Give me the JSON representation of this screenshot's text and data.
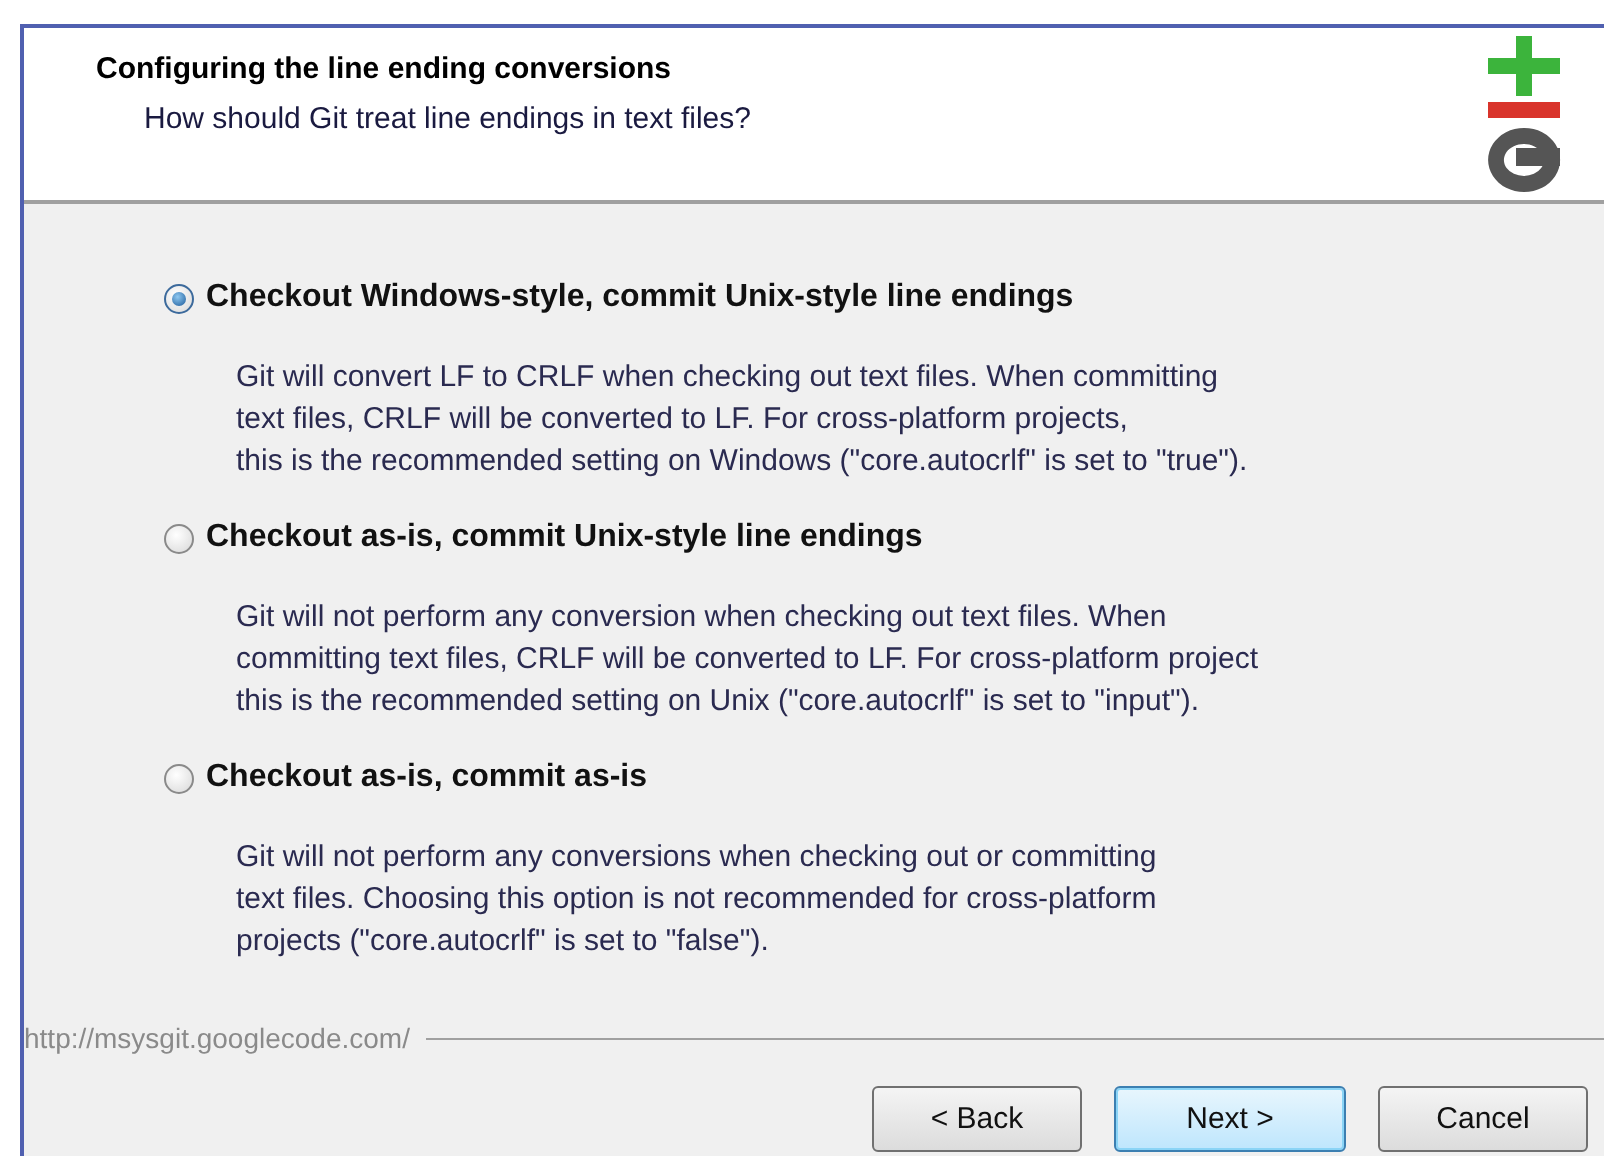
{
  "header": {
    "title": "Configuring the line ending conversions",
    "subtitle": "How should Git treat line endings in text files?"
  },
  "options": [
    {
      "label": "Checkout Windows-style, commit Unix-style line endings",
      "selected": true,
      "description": [
        "Git will convert LF to CRLF when checking out text files. When committing",
        "text files, CRLF will be converted to LF. For cross-platform projects,",
        "this is the recommended setting on Windows (\"core.autocrlf\" is set to \"true\")."
      ]
    },
    {
      "label": "Checkout as-is, commit Unix-style line endings",
      "selected": false,
      "description": [
        "Git will not perform any conversion when checking out text files. When",
        "committing text files, CRLF will be converted to LF. For cross-platform project",
        "this is the recommended setting on Unix (\"core.autocrlf\" is set to \"input\")."
      ]
    },
    {
      "label": "Checkout as-is, commit as-is",
      "selected": false,
      "description": [
        "Git will not perform any conversions when checking out or committing",
        "text files. Choosing this option is not recommended for cross-platform",
        "projects (\"core.autocrlf\" is set to \"false\")."
      ]
    }
  ],
  "footer": {
    "url": "http://msysgit.googlecode.com/"
  },
  "buttons": [
    {
      "label": "< Back",
      "default": false
    },
    {
      "label": "Next >",
      "default": true
    },
    {
      "label": "Cancel",
      "default": false
    }
  ]
}
